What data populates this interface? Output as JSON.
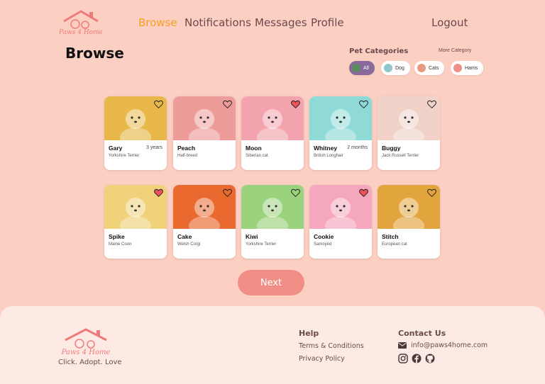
{
  "header": {
    "logo_text": "Paws 4 Home",
    "nav": [
      {
        "label": "Browse",
        "active": true
      },
      {
        "label": "Notifications",
        "active": false
      },
      {
        "label": "Messages",
        "active": false
      },
      {
        "label": "Profile",
        "active": false
      }
    ],
    "logout_label": "Logout"
  },
  "page_title": "Browse",
  "categories": {
    "title": "Pet Categories",
    "more_label": "More Category",
    "chips": [
      {
        "label": "All",
        "selected": true,
        "icon": "paw-icon"
      },
      {
        "label": "Dog",
        "selected": false,
        "icon": "dog-icon"
      },
      {
        "label": "Cats",
        "selected": false,
        "icon": "cat-icon"
      },
      {
        "label": "Hams",
        "selected": false,
        "icon": "hamster-icon"
      }
    ]
  },
  "pets": [
    {
      "name": "Gary",
      "age": "3 years",
      "breed": "Yorkshire Terrier",
      "favorited": false,
      "bg": "#e8b94a"
    },
    {
      "name": "Peach",
      "age": "",
      "breed": "Half-breed",
      "favorited": false,
      "bg": "#ee9c9a"
    },
    {
      "name": "Moon",
      "age": "",
      "breed": "Siberian cat",
      "favorited": true,
      "bg": "#f2a3ad"
    },
    {
      "name": "Whitney",
      "age": "2 months",
      "breed": "British Longhair",
      "favorited": false,
      "bg": "#8fdad6"
    },
    {
      "name": "Buggy",
      "age": "",
      "breed": "Jack Russell Terrier",
      "favorited": false,
      "bg": "#f0d2c8"
    },
    {
      "name": "Spike",
      "age": "",
      "breed": "Maine Coon",
      "favorited": true,
      "bg": "#efd27a"
    },
    {
      "name": "Cake",
      "age": "",
      "breed": "Welsh Corgi",
      "favorited": false,
      "bg": "#e9692e"
    },
    {
      "name": "Kiwi",
      "age": "",
      "breed": "Yorkshire Terrier",
      "favorited": false,
      "bg": "#9bd27d"
    },
    {
      "name": "Cookie",
      "age": "",
      "breed": "Samoyed",
      "favorited": true,
      "bg": "#f4a7bd"
    },
    {
      "name": "Stitch",
      "age": "",
      "breed": "European cat",
      "favorited": false,
      "bg": "#e2a43d"
    }
  ],
  "next_label": "Next",
  "footer": {
    "logo_text": "Paws 4 Home",
    "tagline": "Click. Adopt. Love",
    "help_heading": "Help",
    "help_links": [
      "Terms & Conditions",
      "Privacy Policy"
    ],
    "contact_heading": "Contact Us",
    "email": "info@paws4home.com",
    "social_icons": [
      "instagram-icon",
      "facebook-icon",
      "github-icon"
    ]
  },
  "colors": {
    "page_bg": "#fccfc3",
    "accent": "#f6a021",
    "brand": "#f08e86",
    "footer_bg": "#fdeae5",
    "heart_filled": "#f0525a"
  }
}
